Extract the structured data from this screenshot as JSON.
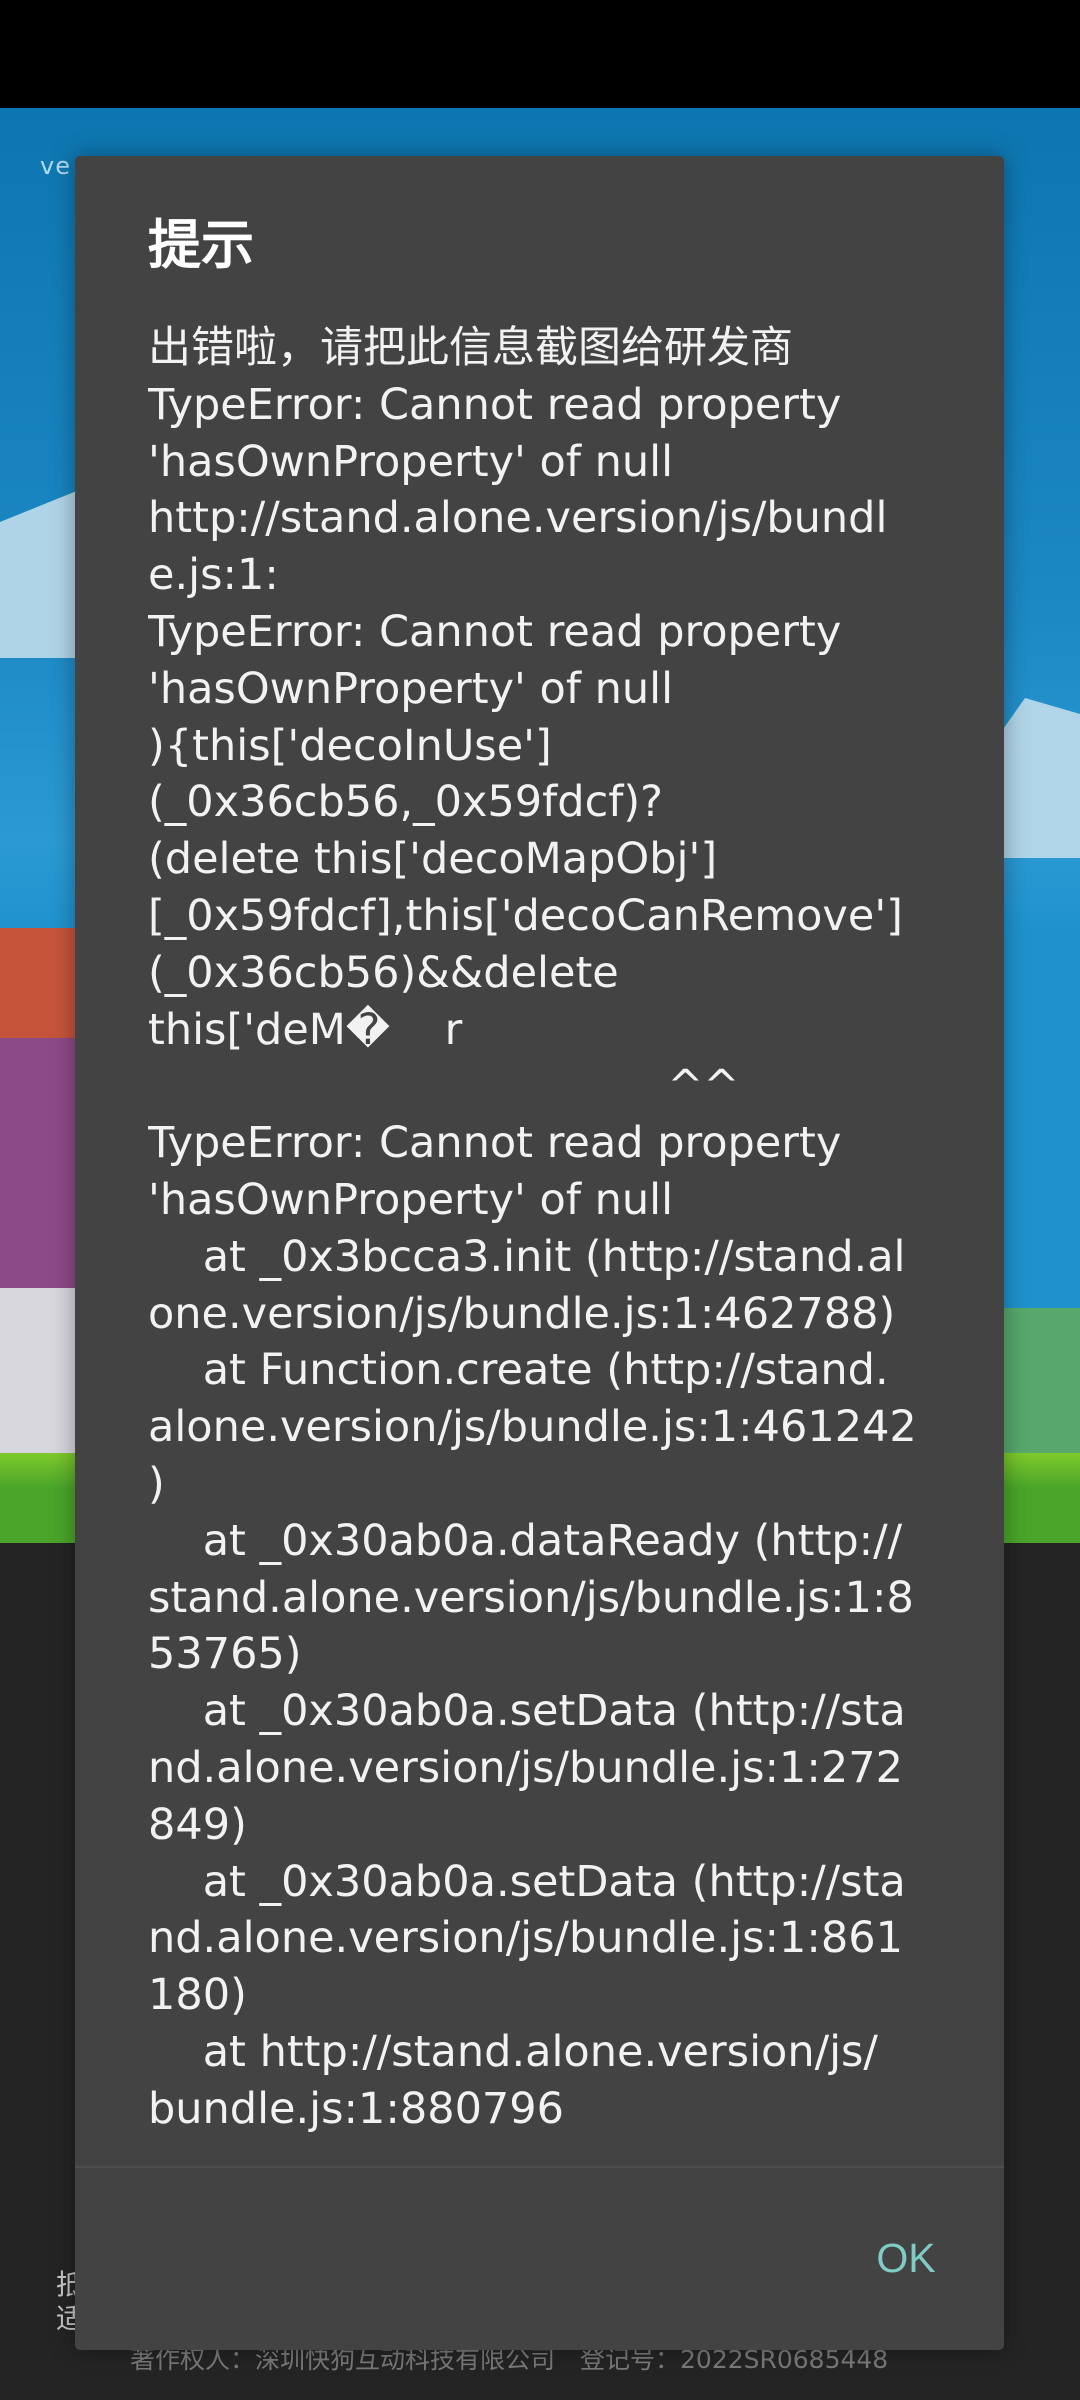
{
  "background": {
    "version_prefix": "ve",
    "left_hint_lines": [
      "抵",
      "适"
    ],
    "copyright": "著作权人：深圳快狗互动科技有限公司　登记号：2022SR0685448"
  },
  "dialog": {
    "title": "提示",
    "message_lines": [
      "出错啦，请把此信息截图给研发商",
      "TypeError: Cannot read property",
      "'hasOwnProperty' of null",
      "http://stand.alone.version/js/bundl",
      "e.js:1:",
      "TypeError: Cannot read property",
      "'hasOwnProperty' of null",
      "){this['decoInUse']",
      "(_0x36cb56,_0x59fdcf)?",
      "(delete this['decoMapObj']",
      "[_0x59fdcf],this['decoCanRemove']",
      "(_0x36cb56)&&delete",
      "this['deM�    r",
      "                                      ^^",
      "TypeError: Cannot read property",
      "'hasOwnProperty' of null",
      "    at _0x3bcca3.init (http://stand.al",
      "one.version/js/bundle.js:1:462788)",
      "    at Function.create (http://stand.",
      "alone.version/js/bundle.js:1:461242",
      ")",
      "    at _0x30ab0a.dataReady (http://",
      "stand.alone.version/js/bundle.js:1:8",
      "53765)",
      "    at _0x30ab0a.setData (http://sta",
      "nd.alone.version/js/bundle.js:1:272",
      "849)",
      "    at _0x30ab0a.setData (http://sta",
      "nd.alone.version/js/bundle.js:1:861",
      "180)",
      "    at http://stand.alone.version/js/",
      "bundle.js:1:880796"
    ],
    "ok_label": "OK"
  },
  "colors": {
    "dialog_background": "#434343",
    "dialog_text": "#f2f2f2",
    "ok_button": "#80cbc4"
  }
}
